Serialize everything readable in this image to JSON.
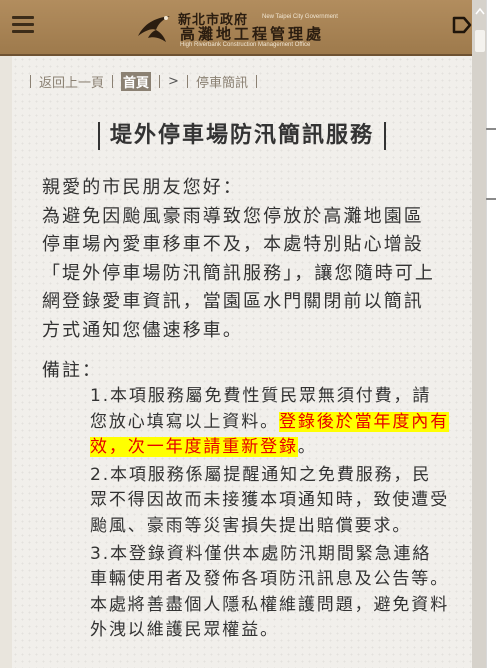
{
  "header": {
    "logo_zh_line1": "新北市政府",
    "logo_en_line1": "New Taipei City Government",
    "logo_zh_line2": "高灘地工程管理處",
    "logo_en_line2": "High Riverbank Construction Management Office"
  },
  "breadcrumb": {
    "back": "返回上一頁",
    "home": "首頁",
    "separator": ">",
    "current": "停車簡訊"
  },
  "page": {
    "title": "堤外停車場防汛簡訊服務",
    "greeting": "親愛的市民朋友您好：",
    "intro": "為避免因颱風豪雨導致您停放於高灘地園區停車場內愛車移車不及，本處特別貼心增設「堤外停車場防汛簡訊服務」，讓您隨時可上網登錄愛車資訊，當園區水門關閉前以簡訊方式通知您儘速移車。",
    "notes_label": "備註：",
    "note1_before": "1.本項服務屬免費性質民眾無須付費，請您放心填寫以上資料。",
    "note1_highlight": "登錄後於當年度內有效，次一年度請重新登錄",
    "note1_after": "。",
    "note2": "2.本項服務係屬提醒通知之免費服務，民眾不得因故而未接獲本項通知時，致使遭受颱風、豪雨等災害損失提出賠償要求。",
    "note3": "3.本登錄資料僅供本處防汛期間緊急連絡車輛使用者及發佈各項防汛訊息及公告等。本處將善盡個人隱私權維護問題，避免資料外洩以維護民眾權益。"
  },
  "colors": {
    "header_bg": "#a7845a",
    "highlight_bg": "#ffff00",
    "highlight_text": "#e60000",
    "breadcrumb_text": "#8b8173"
  },
  "icons": {
    "menu": "hamburger-icon",
    "logo": "bird-emblem-icon",
    "tag": "tag-icon"
  }
}
